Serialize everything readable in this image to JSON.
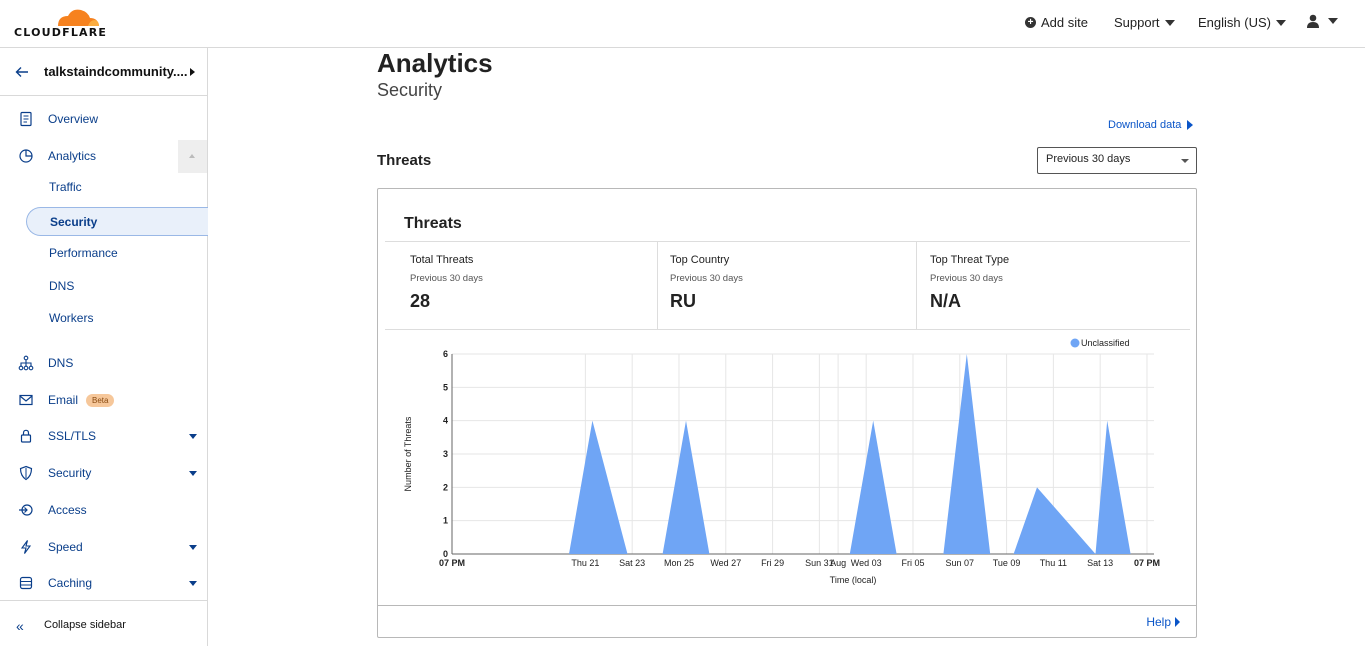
{
  "brand": {
    "logo_text": "CLOUDFLARE",
    "cloud_color": "#f6821f"
  },
  "topbar": {
    "add_site": "Add site",
    "support": "Support",
    "language": "English (US)"
  },
  "sidebar": {
    "site_name": "talkstaindcommunity....",
    "items": [
      {
        "label": "Overview",
        "icon": "document-icon"
      },
      {
        "label": "Analytics",
        "icon": "pie-chart-icon"
      },
      {
        "label": "DNS",
        "icon": "network-icon"
      },
      {
        "label": "Email",
        "icon": "envelope-icon",
        "badge": "Beta"
      },
      {
        "label": "SSL/TLS",
        "icon": "lock-icon"
      },
      {
        "label": "Security",
        "icon": "shield-icon"
      },
      {
        "label": "Access",
        "icon": "access-icon"
      },
      {
        "label": "Speed",
        "icon": "lightning-icon"
      },
      {
        "label": "Caching",
        "icon": "cache-icon"
      }
    ],
    "analytics_sub": [
      "Traffic",
      "Security",
      "Performance",
      "DNS",
      "Workers"
    ],
    "active_sub": "Security",
    "collapse_label": "Collapse sidebar"
  },
  "main": {
    "title": "Analytics",
    "subtitle": "Security",
    "download": "Download data",
    "section_title": "Threats",
    "range_select": "Previous 30 days",
    "card_title": "Threats",
    "stats": [
      {
        "label": "Total Threats",
        "period": "Previous 30 days",
        "value": "28"
      },
      {
        "label": "Top Country",
        "period": "Previous 30 days",
        "value": "RU"
      },
      {
        "label": "Top Threat Type",
        "period": "Previous 30 days",
        "value": "N/A"
      }
    ],
    "help": "Help"
  },
  "chart_data": {
    "type": "area",
    "xlabel": "Time (local)",
    "ylabel": "Number of Threats",
    "ylim": [
      0,
      6
    ],
    "yticks": [
      0,
      1,
      2,
      3,
      4,
      5,
      6
    ],
    "xticks": [
      "07 PM",
      "Thu 21",
      "Sat 23",
      "Mon 25",
      "Wed 27",
      "Fri 29",
      "Sun 31",
      "Aug",
      "Wed 03",
      "Fri 05",
      "Sun 07",
      "Tue 09",
      "Thu 11",
      "Sat 13",
      "07 PM"
    ],
    "grid": true,
    "legend_position": "top-right",
    "series": [
      {
        "name": "Unclassified",
        "color": "#6fa5f5",
        "x": [
          0,
          4,
          5,
          6,
          7.5,
          8,
          9,
          10,
          11,
          13,
          14,
          15,
          16,
          17,
          18,
          19,
          20,
          21,
          22,
          23,
          24,
          25,
          27.5,
          28,
          29,
          30
        ],
        "values": [
          0,
          0,
          0,
          4,
          0,
          0,
          0,
          4,
          0,
          0,
          0,
          0,
          0,
          0,
          4,
          0,
          0,
          0,
          6,
          0,
          0,
          2,
          0,
          4,
          0,
          0
        ]
      }
    ]
  }
}
